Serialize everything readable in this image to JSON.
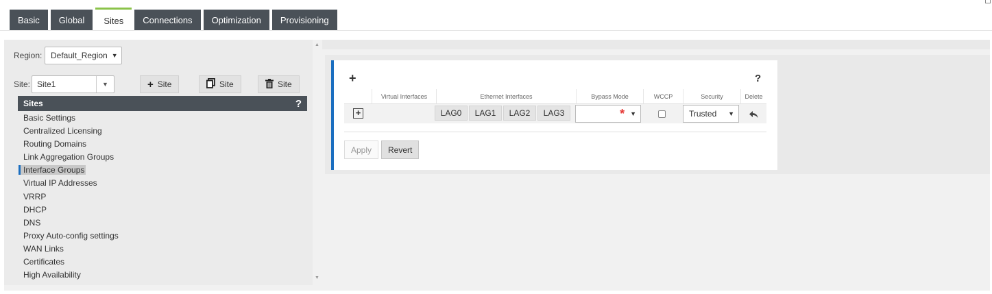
{
  "tabs": [
    {
      "label": "Basic",
      "active": false
    },
    {
      "label": "Global",
      "active": false
    },
    {
      "label": "Sites",
      "active": true
    },
    {
      "label": "Connections",
      "active": false
    },
    {
      "label": "Optimization",
      "active": false
    },
    {
      "label": "Provisioning",
      "active": false
    }
  ],
  "left": {
    "region_label": "Region:",
    "region_value": "Default_Region",
    "site_label": "Site:",
    "site_value": "Site1",
    "add_site_label": "Site",
    "clone_site_label": "Site",
    "delete_site_label": "Site",
    "sites_header": "Sites",
    "help": "?",
    "nav": [
      "Basic Settings",
      "Centralized Licensing",
      "Routing Domains",
      "Link Aggregation Groups",
      "Interface Groups",
      "Virtual IP Addresses",
      "VRRP",
      "DHCP",
      "DNS",
      "Proxy Auto-config settings",
      "WAN Links",
      "Certificates",
      "High Availability"
    ],
    "selected_index": 4
  },
  "card": {
    "add": "+",
    "help": "?",
    "headers": [
      "Virtual Interfaces",
      "Ethernet Interfaces",
      "Bypass Mode",
      "WCCP",
      "Security",
      "Delete"
    ],
    "row": {
      "lags": [
        "LAG0",
        "LAG1",
        "LAG2",
        "LAG3"
      ],
      "bypass_required": "*",
      "wccp_checked": false,
      "security": "Trusted"
    },
    "apply_label": "Apply",
    "revert_label": "Revert"
  },
  "icons": {
    "add": "plus-icon",
    "clone": "copy-icon",
    "delete": "trash-icon",
    "expand": "expand-icon",
    "row_delete": "undo-arrow-icon"
  },
  "colors": {
    "tab_bg": "#4a5158",
    "active_tab_accent": "#8bc34a",
    "card_accent": "#1a6ec0",
    "required": "#e53935"
  }
}
